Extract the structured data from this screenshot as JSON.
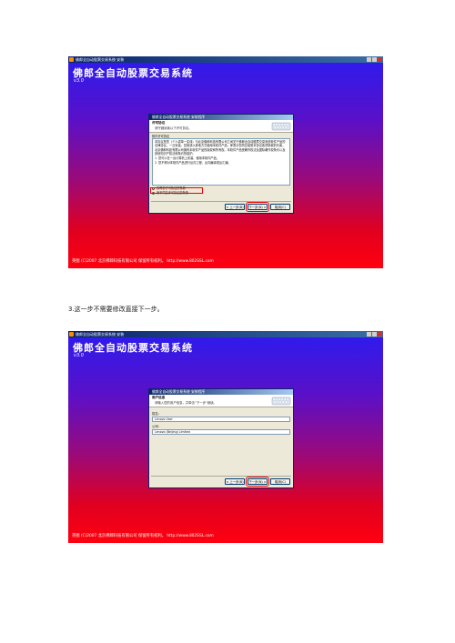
{
  "screenshot1": {
    "window_title": "佛郎全自动股票交易系统  安装",
    "app_title": "佛郎全自动股票交易系统",
    "version": "v3.0",
    "footer": "英图  (C)2007  北京佛郎科技有限公司  保留所有权利。 http://www.802SSL.com",
    "dialog": {
      "title": "佛郎全自动股票交易系统  安装程序",
      "header_title": "许可协议",
      "header_subtitle": "请仔细阅读以下许可协议。",
      "section_label": "软件许可协议",
      "license_paragraphs": [
        "本协议是您（个人或单一实体）与北京佛郎科技有限公司之间关于佛郎全自动股票交易系统软件产品的法律协议。一旦安装、复制或以其他方式使用本软件产品，即表示您同意接受本协议各项条款的约束。",
        "北京佛郎科技有限公司拥有本软件产品的版权和所有权。本软件产品受著作权法及国际著作权条约以及其他知识产权法和条约的保护。",
        "1. 您可以在一台计算机上安装、使用本软件产品。",
        "2. 您不得对本软件产品进行反向工程、反向编译或反汇编。"
      ],
      "radio_accept": "我同意许可协议的条款",
      "radio_decline": "我不同意许可协议的条款",
      "buttons": {
        "back": "< 上一步(B)",
        "next": "下一步(N) >",
        "cancel": "取消(C)"
      }
    }
  },
  "caption": "3.这一步不需要修改直接下一步。",
  "screenshot2": {
    "window_title": "佛郎全自动股票交易系统  安装",
    "app_title": "佛郎全自动股票交易系统",
    "version": "v3.0",
    "footer": "英图  (C)2007  北京佛郎科技有限公司  保留所有权利。 http://www.802SSL.com",
    "dialog": {
      "title": "佛郎全自动股票交易系统  安装程序",
      "header_title": "用户信息",
      "header_subtitle": "请输入您的用户信息，并单击“下一步”继续。",
      "name_label": "姓名:",
      "name_value": "Lenovo User",
      "company_label": "公司:",
      "company_value": "Lenovo (Beijing) Limited",
      "buttons": {
        "back": "< 上一步(B)",
        "next": "下一步(N) >",
        "cancel": "取消(C)"
      }
    }
  }
}
